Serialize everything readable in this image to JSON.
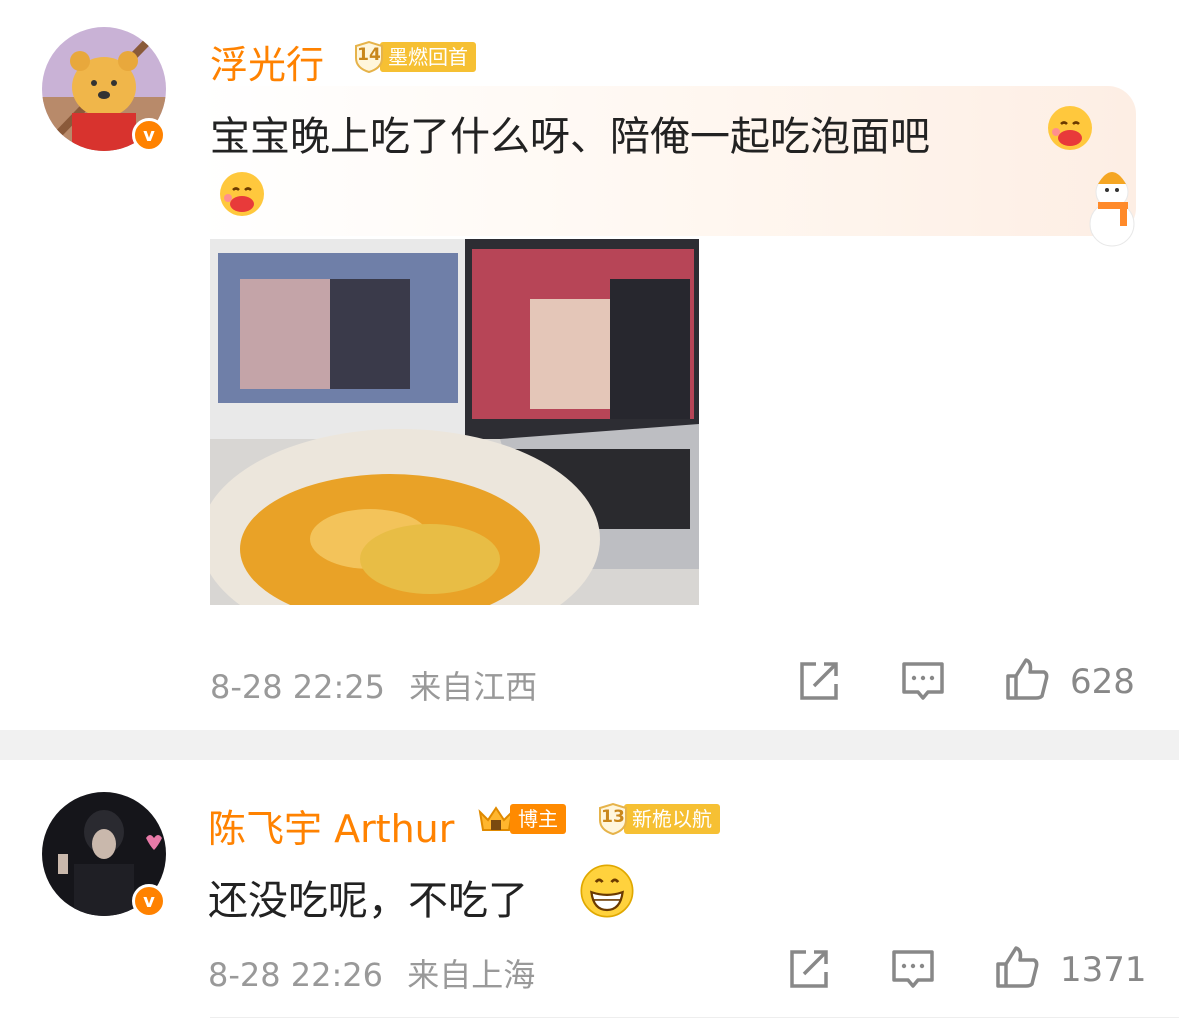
{
  "comments": [
    {
      "username": "浮光行",
      "level": "14",
      "level_title": "墨燃回首",
      "text_line1": "宝宝晚上吃了什么呀、陪俺一起吃泡面吧",
      "time": "8-28 22:25",
      "location": "来自江西",
      "likes": "628",
      "verified": "v",
      "emoji": "hug-face-emoji"
    },
    {
      "username": "陈飞宇 Arthur",
      "boss_label": "博主",
      "level": "13",
      "level_title": "新桅以航",
      "text": "还没吃呢，不吃了",
      "time": "8-28 22:26",
      "location": "来自上海",
      "likes": "1371",
      "verified": "v",
      "emoji": "grin-face-emoji"
    }
  ],
  "colors": {
    "accent": "#ff8200",
    "badge_yellow": "#f6c033",
    "meta_gray": "#999999",
    "divider": "#f1f1f1"
  },
  "icons": [
    "repost-icon",
    "comment-icon",
    "like-icon"
  ]
}
